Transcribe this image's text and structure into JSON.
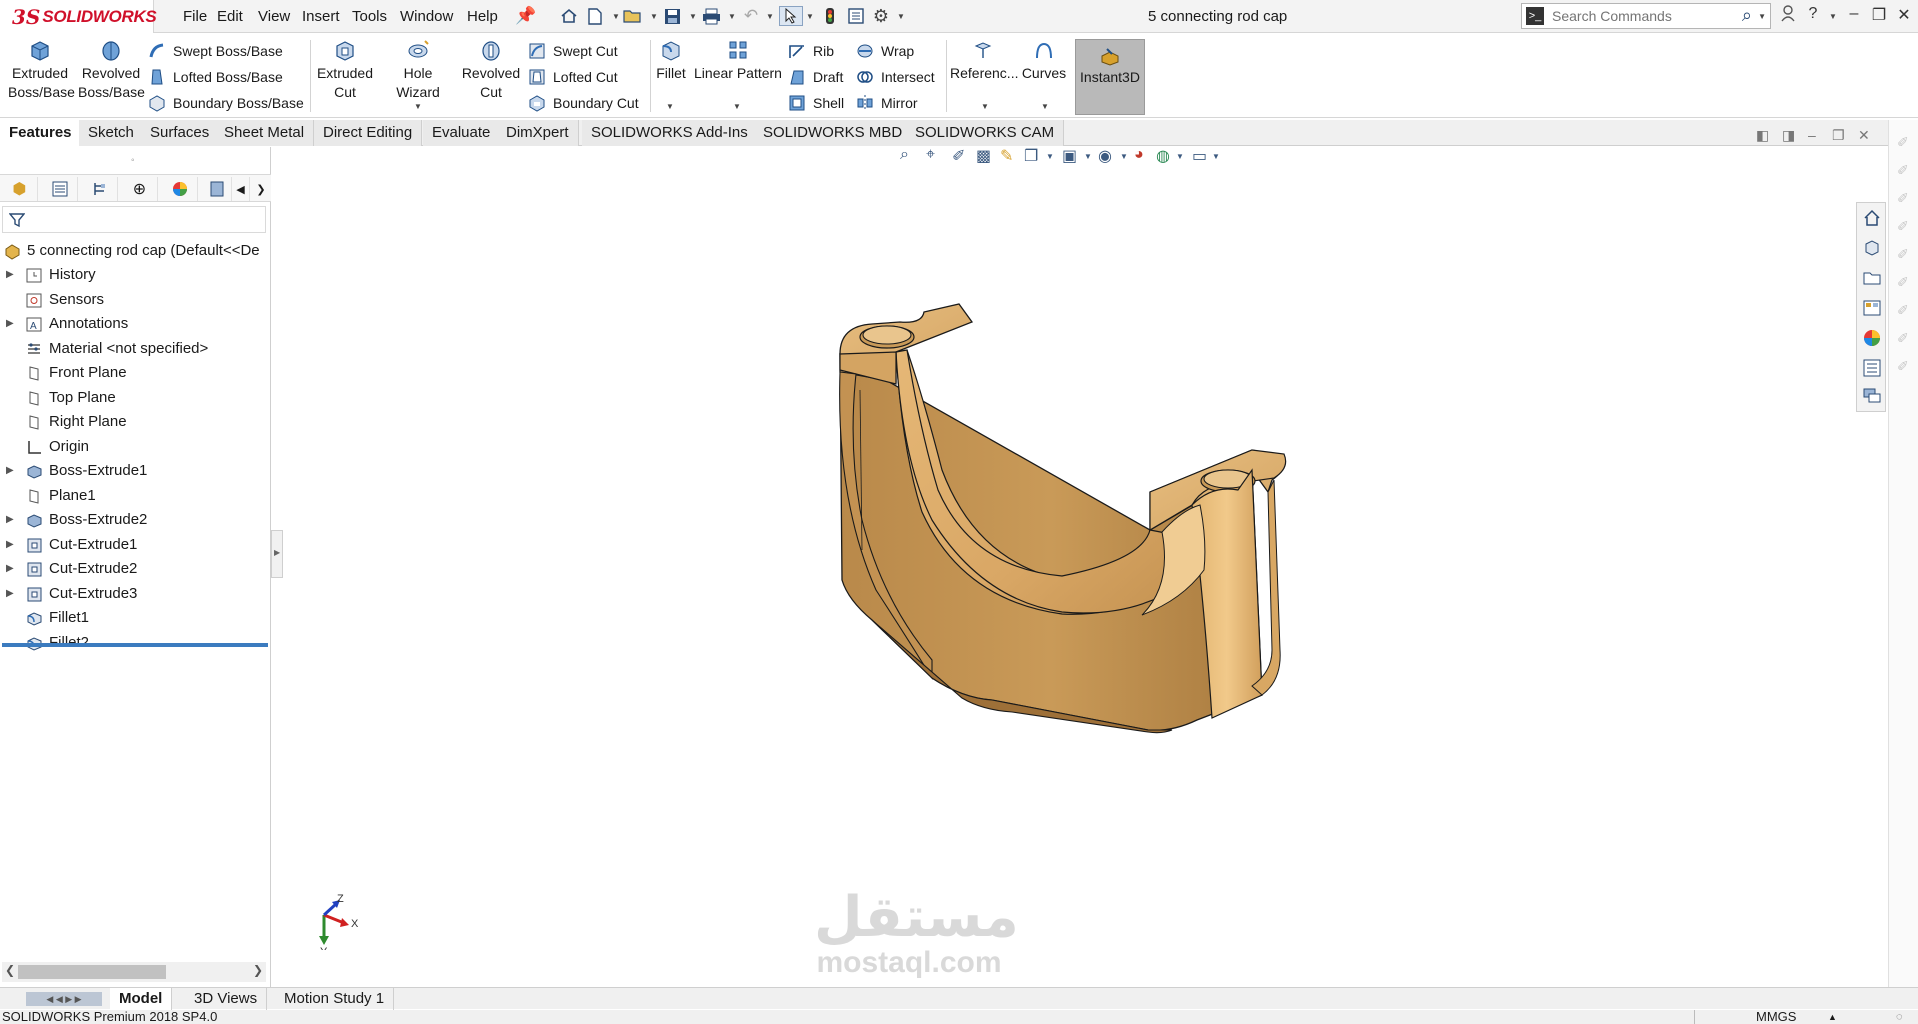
{
  "app": {
    "logo_ds": "3S",
    "logo_text": "SOLIDWORKS",
    "doc_title": "5 connecting rod cap"
  },
  "menu": [
    "File",
    "Edit",
    "View",
    "Insert",
    "Tools",
    "Window",
    "Help"
  ],
  "search": {
    "placeholder": "Search Commands"
  },
  "ribbon": {
    "extruded_boss": [
      "Extruded",
      "Boss/Base"
    ],
    "revolved_boss": [
      "Revolved",
      "Boss/Base"
    ],
    "swept_boss": "Swept Boss/Base",
    "lofted_boss": "Lofted Boss/Base",
    "boundary_boss": "Boundary Boss/Base",
    "extruded_cut": [
      "Extruded",
      "Cut"
    ],
    "hole_wizard": "Hole Wizard",
    "revolved_cut": [
      "Revolved",
      "Cut"
    ],
    "swept_cut": "Swept Cut",
    "lofted_cut": "Lofted Cut",
    "boundary_cut": "Boundary Cut",
    "fillet": "Fillet",
    "linear_pattern": "Linear Pattern",
    "rib": "Rib",
    "draft": "Draft",
    "shell": "Shell",
    "wrap": "Wrap",
    "intersect": "Intersect",
    "mirror": "Mirror",
    "reference": "Referenc...",
    "curves": "Curves",
    "instant3d": "Instant3D"
  },
  "tabs": [
    "Features",
    "Sketch",
    "Surfaces",
    "Sheet Metal",
    "Direct Editing",
    "Evaluate",
    "DimXpert",
    "SOLIDWORKS Add-Ins",
    "SOLIDWORKS MBD",
    "SOLIDWORKS CAM"
  ],
  "tree": {
    "root": "5 connecting rod cap  (Default<<De",
    "items": [
      {
        "label": "History",
        "icon": "history-icon",
        "expandable": true
      },
      {
        "label": "Sensors",
        "icon": "sensors-icon",
        "expandable": false
      },
      {
        "label": "Annotations",
        "icon": "annotations-icon",
        "expandable": true
      },
      {
        "label": "Material <not specified>",
        "icon": "material-icon",
        "expandable": false
      },
      {
        "label": "Front Plane",
        "icon": "plane-icon",
        "expandable": false
      },
      {
        "label": "Top Plane",
        "icon": "plane-icon",
        "expandable": false
      },
      {
        "label": "Right Plane",
        "icon": "plane-icon",
        "expandable": false
      },
      {
        "label": "Origin",
        "icon": "origin-icon",
        "expandable": false
      },
      {
        "label": "Boss-Extrude1",
        "icon": "extrude-icon",
        "expandable": true
      },
      {
        "label": "Plane1",
        "icon": "plane-icon",
        "expandable": false
      },
      {
        "label": "Boss-Extrude2",
        "icon": "extrude-icon",
        "expandable": true
      },
      {
        "label": "Cut-Extrude1",
        "icon": "cut-extrude-icon",
        "expandable": true
      },
      {
        "label": "Cut-Extrude2",
        "icon": "cut-extrude-icon",
        "expandable": true
      },
      {
        "label": "Cut-Extrude3",
        "icon": "cut-extrude-icon",
        "expandable": true
      },
      {
        "label": "Fillet1",
        "icon": "fillet-icon",
        "expandable": false
      },
      {
        "label": "Fillet2",
        "icon": "fillet-icon",
        "expandable": false
      }
    ]
  },
  "triad": {
    "z": "Z",
    "x": "X",
    "y": "Y"
  },
  "watermark": {
    "arabic": "مستقل",
    "latin": "mostaql.com"
  },
  "bottom_tabs": [
    "Model",
    "3D Views",
    "Motion Study 1"
  ],
  "status": {
    "product": "SOLIDWORKS Premium 2018 SP4.0",
    "units": "MMGS"
  },
  "colors": {
    "brand": "#d0102a",
    "part": "#d9a765",
    "rollback": "#3b7bbf"
  }
}
